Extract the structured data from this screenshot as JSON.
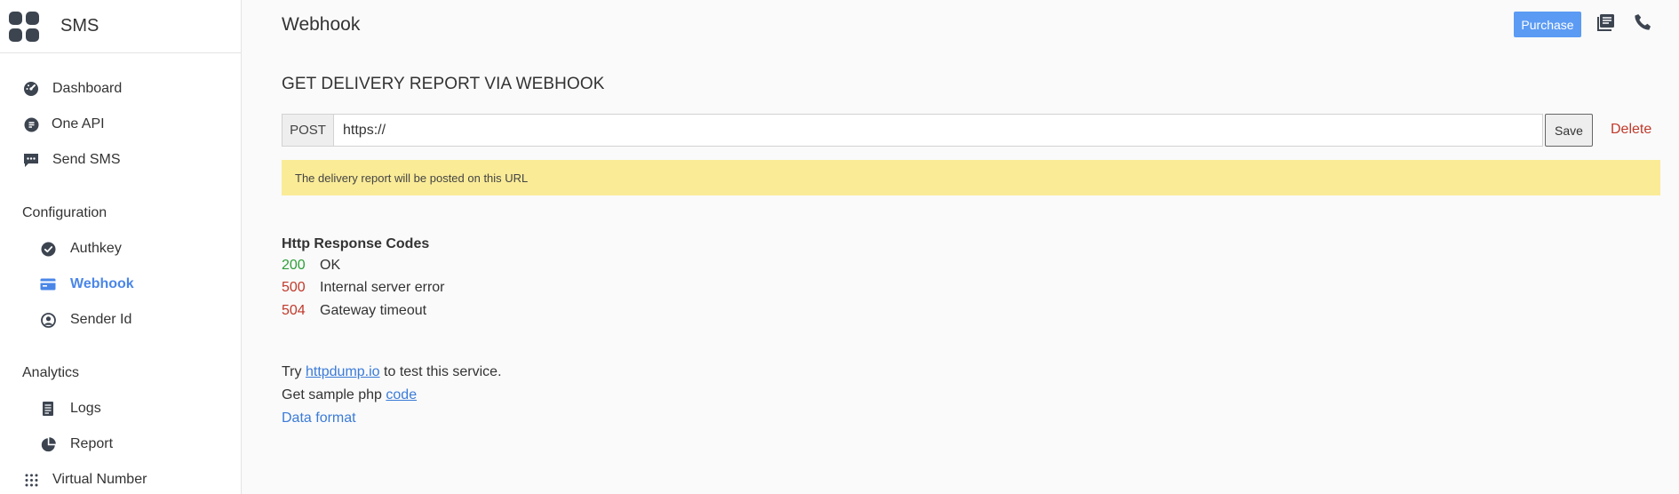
{
  "app": {
    "title": "SMS"
  },
  "sidebar": {
    "items": [
      {
        "label": "Dashboard",
        "icon": "speedometer-icon"
      },
      {
        "label": "One API",
        "icon": "api-icon"
      },
      {
        "label": "Send SMS",
        "icon": "message-icon"
      }
    ],
    "configuration": {
      "label": "Configuration",
      "items": [
        {
          "label": "Authkey",
          "icon": "check-circle-icon"
        },
        {
          "label": "Webhook",
          "icon": "webhook-icon",
          "active": true
        },
        {
          "label": "Sender Id",
          "icon": "user-id-icon"
        }
      ]
    },
    "analytics": {
      "label": "Analytics",
      "items": [
        {
          "label": "Logs",
          "icon": "logs-icon"
        },
        {
          "label": "Report",
          "icon": "pie-chart-icon"
        }
      ]
    },
    "virtual_number": {
      "label": "Virtual Number",
      "icon": "grid-dots-icon"
    }
  },
  "header": {
    "title": "Webhook",
    "purchase_label": "Purchase",
    "icons": [
      "docs-icon",
      "phone-icon"
    ]
  },
  "main": {
    "section_title": "GET DELIVERY REPORT VIA WEBHOOK",
    "method": "POST",
    "url_value": "https://",
    "save_label": "Save",
    "delete_label": "Delete",
    "notice": "The delivery report will be posted on this URL",
    "codes_title": "Http Response Codes",
    "codes": [
      {
        "code": "200",
        "desc": "OK",
        "status": "success"
      },
      {
        "code": "500",
        "desc": "Internal server error",
        "status": "error"
      },
      {
        "code": "504",
        "desc": "Gateway timeout",
        "status": "error"
      }
    ],
    "help": {
      "try_prefix": "Try",
      "try_link": "httpdump.io",
      "try_suffix": "to test this service.",
      "sample_prefix": "Get sample php",
      "sample_link": "code",
      "data_format": "Data format"
    }
  },
  "colors": {
    "accent": "#4a86e8",
    "purchase": "#5b9bf4",
    "notice": "#faeb97",
    "success": "#2e9e3a",
    "error": "#c0392b"
  }
}
